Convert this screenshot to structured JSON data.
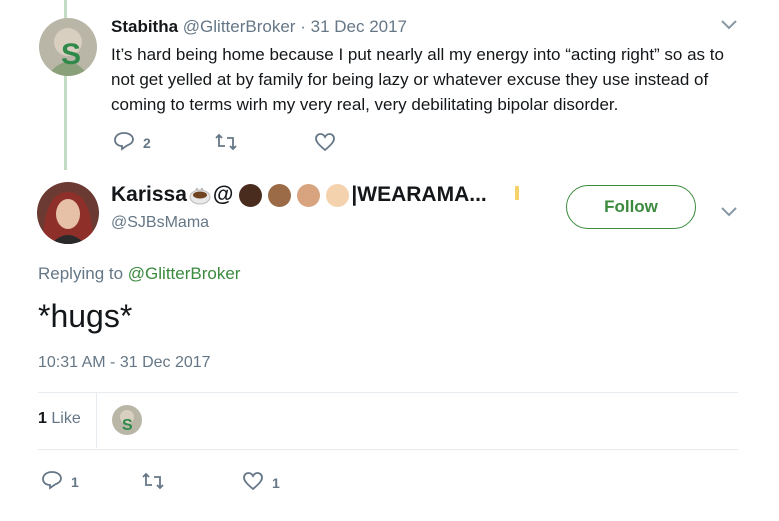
{
  "parent_tweet": {
    "name": "Stabitha",
    "handle": "@GlitterBroker",
    "date_separator": "·",
    "date": "31 Dec 2017",
    "text": "It’s hard being home because I put nearly all my energy into “acting right” so as to not get yelled at by family for being lazy or whatever excuse they use instead of coming to terms wirh my very real, very debilitating bipolar disorder.",
    "reply_count": "2",
    "icons": [
      "reply-icon",
      "retweet-icon",
      "like-icon",
      "chevron-down-icon"
    ]
  },
  "main_tweet": {
    "name_prefix": "Karissa",
    "name_at": "@",
    "name_suffix": "|WEARAMA...",
    "fist_colors": [
      "#4a2c1e",
      "#9b6b47",
      "#d8a47f",
      "#f3d2ad"
    ],
    "handle": "@SJBsMama",
    "follow_label": "Follow",
    "replying_prefix": "Replying to",
    "replying_handle": "@GlitterBroker",
    "text": "*hugs*",
    "timestamp": "10:31 AM - 31 Dec 2017",
    "like_count": "1",
    "like_label": "Like",
    "reply_count": "1",
    "like_action_count": "1",
    "accent_color": "#3b8a3e"
  }
}
